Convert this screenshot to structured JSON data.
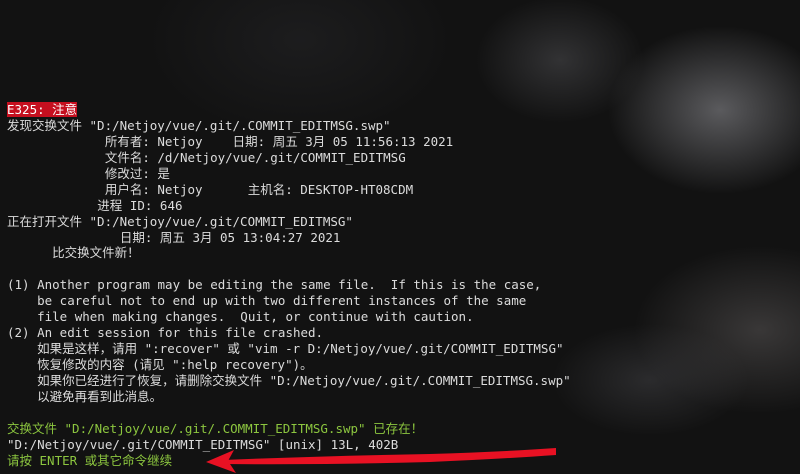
{
  "window": {
    "type": "vim-swap-warning-terminal"
  },
  "colors": {
    "error_bg": "#c50f1f",
    "text": "#dcdcdc",
    "green": "#8cc63f",
    "arrow": "#e81123"
  },
  "lines": [
    "E325: 注意",
    "发现交换文件 \"D:/Netjoy/vue/.git/.COMMIT_EDITMSG.swp\"",
    "             所有者: Netjoy    日期: 周五 3月 05 11:56:13 2021",
    "             文件名: /d/Netjoy/vue/.git/COMMIT_EDITMSG",
    "             修改过: 是",
    "             用户名: Netjoy      主机名: DESKTOP-HT08CDM",
    "            进程 ID: 646",
    "正在打开文件 \"D:/Netjoy/vue/.git/COMMIT_EDITMSG\"",
    "               日期: 周五 3月 05 13:04:27 2021",
    "      比交换文件新！",
    "",
    "(1) Another program may be editing the same file.  If this is the case,",
    "    be careful not to end up with two different instances of the same",
    "    file when making changes.  Quit, or continue with caution.",
    "(2) An edit session for this file crashed.",
    "    如果是这样，请用 \":recover\" 或 \"vim -r D:/Netjoy/vue/.git/COMMIT_EDITMSG\"",
    "    恢复修改的内容 (请见 \":help recovery\")。",
    "    如果你已经进行了恢复，请删除交换文件 \"D:/Netjoy/vue/.git/.COMMIT_EDITMSG.swp\"",
    "    以避免再看到此消息。",
    "",
    "交换文件 \"D:/Netjoy/vue/.git/.COMMIT_EDITMSG.swp\" 已存在！",
    "\"D:/Netjoy/vue/.git/COMMIT_EDITMSG\" [unix] 13L, 402B",
    "请按 ENTER 或其它命令继续"
  ]
}
